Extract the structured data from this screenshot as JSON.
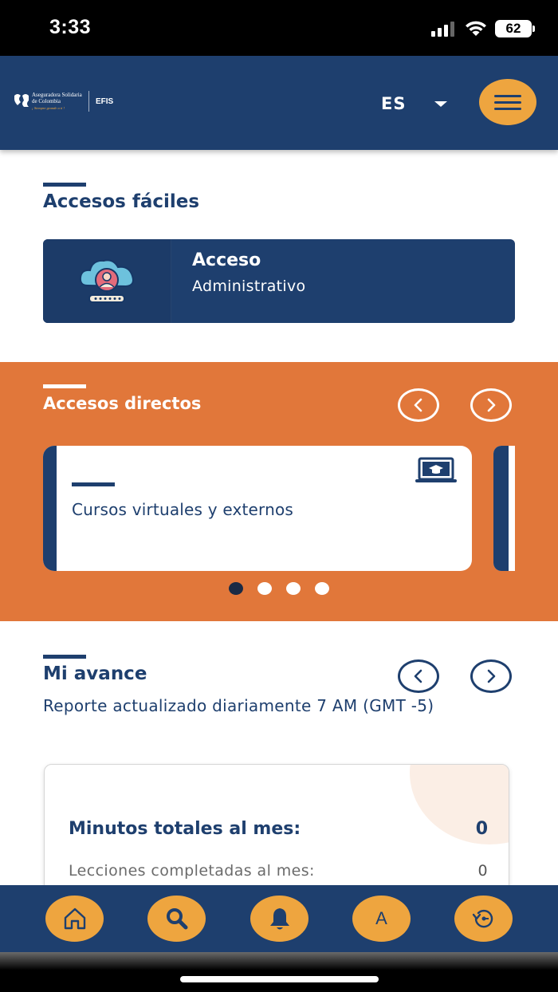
{
  "status_bar": {
    "time": "3:33",
    "battery": "62"
  },
  "header": {
    "logo": {
      "name_line1": "Aseguradora Solidaria",
      "name_line2": "de Colombia",
      "tagline": "¡ Siempre grande a ti !",
      "partner": "EFIS"
    },
    "language": "ES",
    "icons": {
      "menu": "hamburger-icon",
      "lang_caret": "caret-down-icon"
    }
  },
  "easy_access": {
    "title": "Accesos fáciles",
    "card": {
      "title": "Acceso",
      "subtitle": "Administrativo",
      "icon": "cloud-user-icon"
    }
  },
  "direct_access": {
    "title": "Accesos directos",
    "cards": [
      {
        "label": "Cursos virtuales y externos",
        "icon": "laptop-graduation-icon"
      }
    ],
    "pager": {
      "count": 4,
      "active_index": 0
    },
    "colors": {
      "band": "#e1773a"
    }
  },
  "progress": {
    "title": "Mi avance",
    "note": "Reporte actualizado diariamente 7 AM (GMT -5)",
    "stats": [
      {
        "label": "Minutos totales al mes:",
        "value": "0"
      },
      {
        "label": "Lecciones completadas al mes:",
        "value": "0"
      }
    ]
  },
  "bottom_nav": {
    "items": [
      {
        "name": "home",
        "icon": "home-icon"
      },
      {
        "name": "search",
        "icon": "search-icon"
      },
      {
        "name": "notifications",
        "icon": "bell-icon"
      },
      {
        "name": "font-size",
        "icon": "font-letter-icon",
        "label": "A"
      },
      {
        "name": "history",
        "icon": "history-icon"
      }
    ]
  },
  "colors": {
    "primary": "#1e3f6e",
    "accent": "#eea53f",
    "orange": "#e1773a"
  }
}
